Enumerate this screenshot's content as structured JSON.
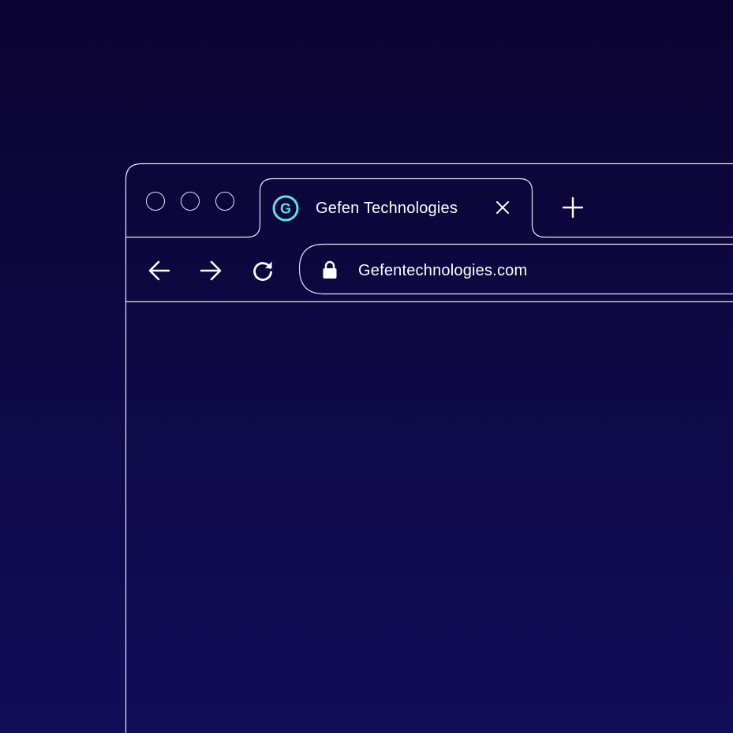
{
  "window_controls": [
    "close",
    "minimize",
    "maximize"
  ],
  "tab": {
    "title": "Gefen Technologies",
    "favicon_letter": "G",
    "favicon_color": "#5ce1e6",
    "close_icon": "close-icon"
  },
  "new_tab_icon": "plus-icon",
  "nav": {
    "back_icon": "arrow-left-icon",
    "forward_icon": "arrow-right-icon",
    "reload_icon": "reload-icon"
  },
  "address_bar": {
    "lock_icon": "lock-icon",
    "url": "Gefentechnologies.com"
  },
  "colors": {
    "background_top": "#0b0330",
    "background_bottom": "#120d58",
    "stroke": "#e8e6f2",
    "accent": "#5ce1e6"
  }
}
